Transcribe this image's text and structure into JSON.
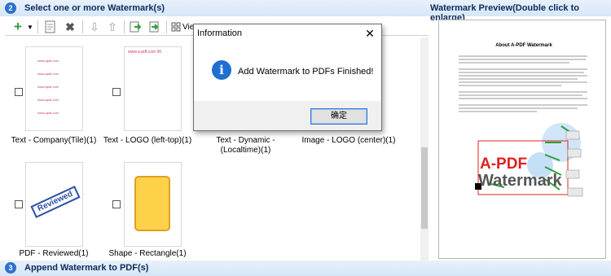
{
  "section_select": {
    "number": "2",
    "title": "Select one or more Watermark(s)"
  },
  "section_append": {
    "number": "3",
    "title": "Append Watermark to PDF(s)"
  },
  "preview": {
    "title": "Watermark Preview(Double click to enlarge)",
    "doc_title": "About A-PDF Watermark",
    "logo_text_1": "A-PDF",
    "logo_text_2": "Watermark"
  },
  "toolbar": {
    "add_icon": "plus-icon",
    "view_label": "Vie"
  },
  "watermarks": [
    {
      "label": "Text - Company(Tile)(1)",
      "thumb_text": "www.apdf.com"
    },
    {
      "label": "Text - LOGO (left-top)(1)",
      "thumb_text": "www.a-pdf.com 00"
    },
    {
      "label": "Text - Dynamic - (Localtime)(1)"
    },
    {
      "label": "Image - LOGO (center)(1)"
    },
    {
      "label": "PDF - Reviewed(1)",
      "thumb_text": "Reviewed"
    },
    {
      "label": "Shape - Rectangle(1)"
    }
  ],
  "dialog": {
    "title": "Information",
    "message": "Add Watermark to PDFs Finished!",
    "ok_label": "确定",
    "close_symbol": "✕"
  },
  "colors": {
    "band": "#d6e6f7",
    "accent_blue": "#2f6fce",
    "reviewed_blue": "#2a4fa8",
    "shape_fill": "#fdd24a",
    "shape_border": "#e0a020",
    "logo_red": "#e02020",
    "green_arrow": "#2e9e3e"
  }
}
